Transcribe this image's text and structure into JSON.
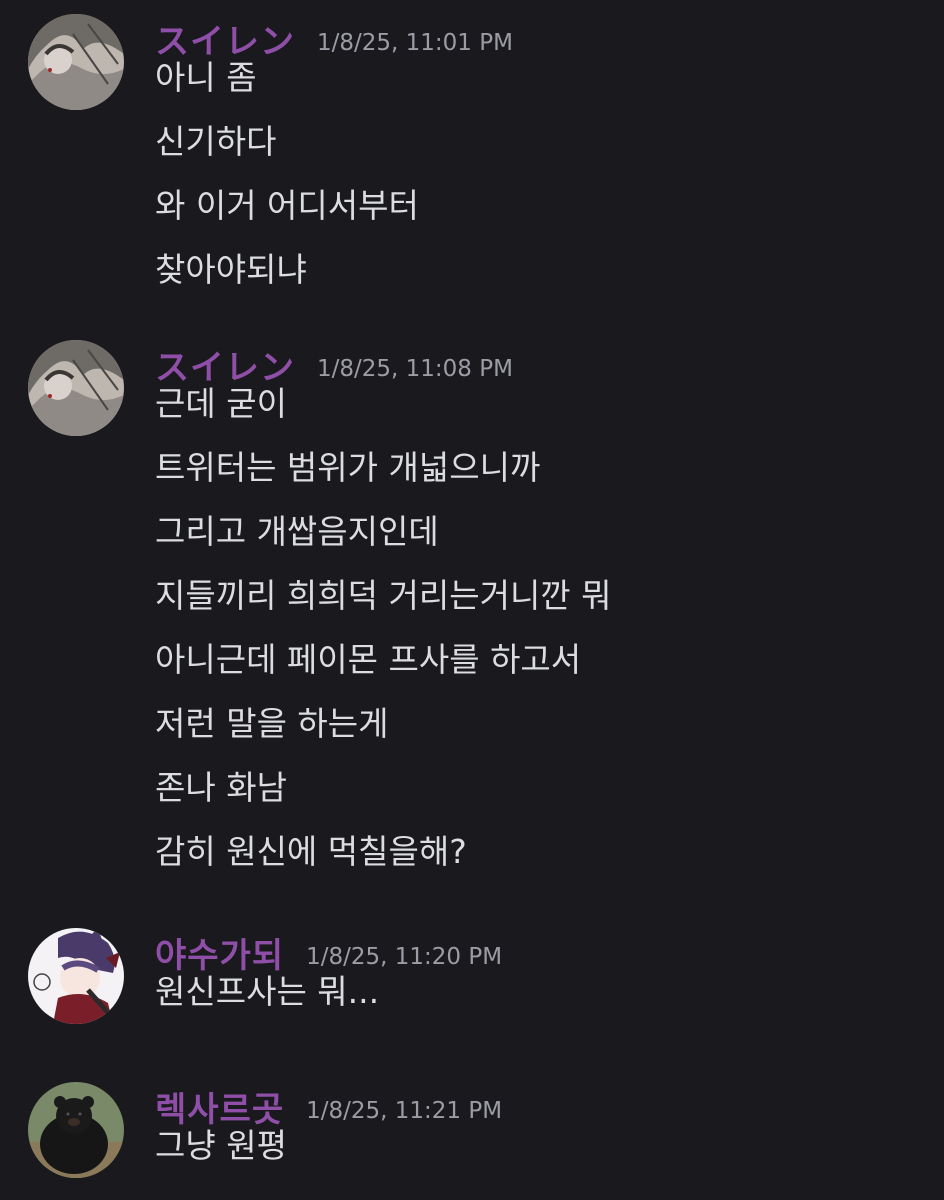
{
  "messages": [
    {
      "username": "スイレン",
      "timestamp": "1/8/25, 11:01 PM",
      "avatar_icon": "avatar-girl-dark-hair",
      "lines": [
        "아니 좀",
        "신기하다",
        "와 이거 어디서부터",
        "찾아야되냐"
      ]
    },
    {
      "username": "スイレン",
      "timestamp": "1/8/25, 11:08 PM",
      "avatar_icon": "avatar-girl-dark-hair",
      "lines": [
        "근데 굳이",
        "트위터는 범위가 개넓으니까",
        "그리고 개쌉음지인데",
        "지들끼리 희희덕 거리는거니깐 뭐",
        "아니근데 페이몬 프사를 하고서",
        "저런 말을 하는게",
        "존나 화남",
        "감히 원신에 먹칠을해?"
      ]
    },
    {
      "username": "야수가되",
      "timestamp": "1/8/25, 11:20 PM",
      "avatar_icon": "avatar-anime-character",
      "lines": [
        "원신프사는 뭐..."
      ]
    },
    {
      "username": "렉사르곳",
      "timestamp": "1/8/25, 11:21 PM",
      "avatar_icon": "avatar-black-bear",
      "lines": [
        "그냥 원평"
      ]
    }
  ],
  "colors": {
    "background": "#1a1a1e",
    "username": "#8f4fa8",
    "timestamp": "#9c9ca5",
    "message_text": "#dcdde1"
  }
}
